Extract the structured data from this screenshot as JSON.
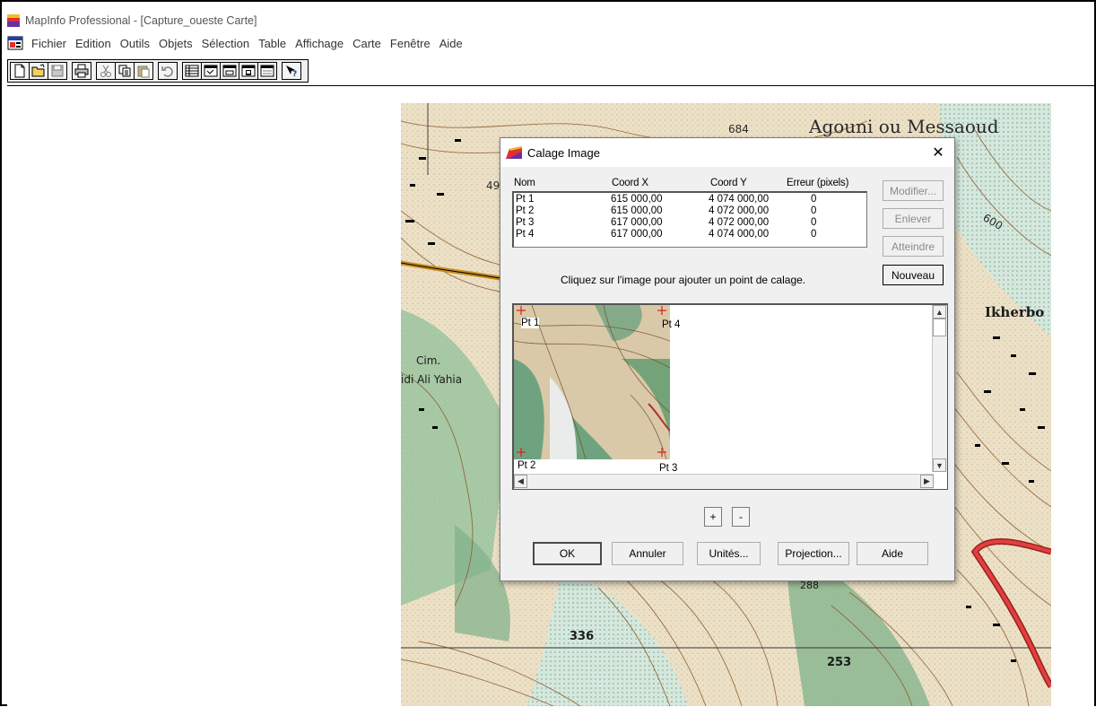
{
  "window": {
    "title": "MapInfo Professional - [Capture_oueste Carte]"
  },
  "menu": [
    {
      "label": "Fichier"
    },
    {
      "label": "Edition"
    },
    {
      "label": "Outils"
    },
    {
      "label": "Objets"
    },
    {
      "label": "Sélection"
    },
    {
      "label": "Table"
    },
    {
      "label": "Affichage"
    },
    {
      "label": "Carte"
    },
    {
      "label": "Fenêtre"
    },
    {
      "label": "Aide"
    }
  ],
  "toolbar_icons": [
    [
      "new-document-icon",
      "open-folder-icon",
      "save-icon"
    ],
    [
      "print-icon"
    ],
    [
      "cut-icon",
      "copy-icon",
      "paste-icon"
    ],
    [
      "undo-icon"
    ],
    [
      "new-browser-icon",
      "new-mapper-icon",
      "new-grapher-icon",
      "new-layout-icon",
      "new-redistrict-icon"
    ],
    [
      "help-pointer-icon"
    ]
  ],
  "map_labels": {
    "village_name": "Agouni ou Messaoud",
    "elev_684": "684",
    "label_49": "49",
    "label_600": "600",
    "village_ikherbo": "Ikherbo",
    "cimetiere": "Cim.",
    "village_sidi": "idi Ali Yahia",
    "elev_336": "336",
    "elev_253": "253",
    "elev_288": "288"
  },
  "dialog": {
    "title": "Calage Image",
    "close_label": "✕",
    "columns": {
      "name": "Nom",
      "x": "Coord X",
      "y": "Coord Y",
      "err": "Erreur (pixels)"
    },
    "points": [
      {
        "name": "Pt 1",
        "x": "615 000,00",
        "y": "4 074 000,00",
        "err": "0"
      },
      {
        "name": "Pt 2",
        "x": "615 000,00",
        "y": "4 072 000,00",
        "err": "0"
      },
      {
        "name": "Pt 3",
        "x": "617 000,00",
        "y": "4 072 000,00",
        "err": "0"
      },
      {
        "name": "Pt 4",
        "x": "617 000,00",
        "y": "4 074 000,00",
        "err": "0"
      }
    ],
    "side_buttons": {
      "modifier": "Modifier...",
      "enlever": "Enlever",
      "atteindre": "Atteindre",
      "nouveau": "Nouveau"
    },
    "instruction": "Cliquez sur l'image pour ajouter un point de calage.",
    "preview_points": [
      "Pt 1",
      "Pt 4",
      "Pt 2",
      "Pt 3"
    ],
    "zoom": {
      "in": "+",
      "out": "-"
    },
    "bottom_buttons": {
      "ok": "OK",
      "annuler": "Annuler",
      "unites": "Unités...",
      "projection": "Projection...",
      "aide": "Aide"
    }
  },
  "colors": {
    "map_base": "#e9dcc0",
    "contour": "#8a5a2e",
    "forest": "#7fb18a",
    "road": "#c0392b",
    "marker": "#e02020"
  }
}
